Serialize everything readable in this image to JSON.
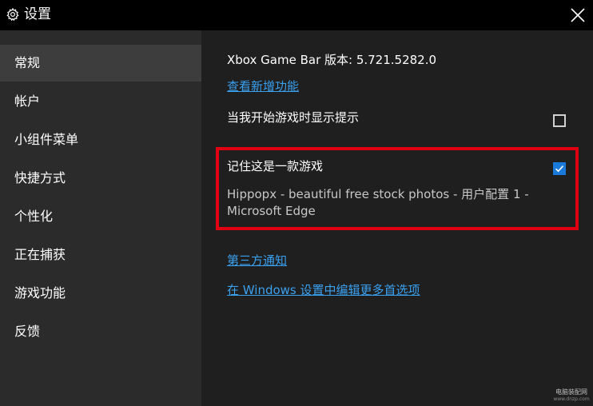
{
  "window": {
    "title": "设置",
    "title_icon": "gear-icon",
    "close_icon": "close-icon"
  },
  "sidebar": {
    "items": [
      {
        "label": "常规",
        "selected": true
      },
      {
        "label": "帐户",
        "selected": false
      },
      {
        "label": "小组件菜单",
        "selected": false
      },
      {
        "label": "快捷方式",
        "selected": false
      },
      {
        "label": "个性化",
        "selected": false
      },
      {
        "label": "正在捕获",
        "selected": false
      },
      {
        "label": "游戏功能",
        "selected": false
      },
      {
        "label": "反馈",
        "selected": false
      }
    ]
  },
  "main": {
    "version": "Xbox Game Bar 版本: 5.721.5282.0",
    "whats_new_link": "查看新增功能",
    "show_tips": {
      "label": "当我开始游戏时显示提示",
      "checked": false
    },
    "remember_game": {
      "label": "记住这是一款游戏",
      "checked": true,
      "app_name": "Hippopx - beautiful free stock photos - 用户配置 1 - Microsoft Edge"
    },
    "third_party_link": "第三方通知",
    "windows_settings_link": "在 Windows 设置中编辑更多首选项"
  },
  "watermark": {
    "line1": "电脑装配网",
    "line2": "www.dnzp.com"
  },
  "colors": {
    "accent": "#1a7ad9",
    "link": "#3aa0f0",
    "highlight": "#e00012",
    "sidebar_bg": "#2b2b2b",
    "main_bg": "#1f1f1f",
    "titlebar_bg": "#000000"
  }
}
